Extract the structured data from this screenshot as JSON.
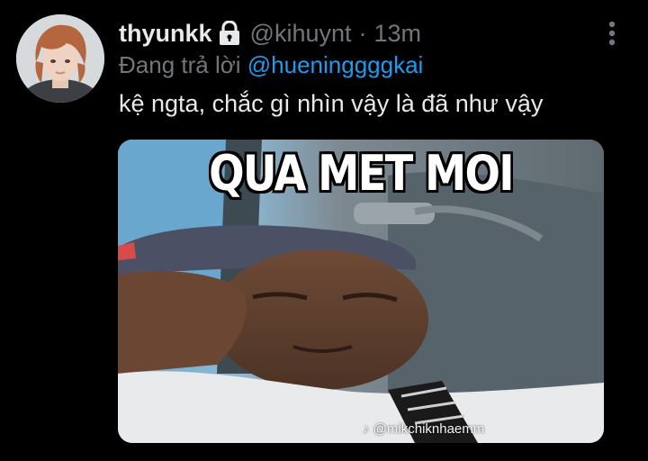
{
  "tweet": {
    "display_name": "thyunkk",
    "handle": "@kihuynt",
    "separator": "·",
    "time": "13m",
    "reply_prefix": "Đang trả lời ",
    "reply_to": "@hueninggggkai",
    "text": "kệ ngta, chắc gì nhìn vậy là đã như vậy",
    "protected_icon": "lock-icon",
    "more_icon": "more-vertical-icon"
  },
  "media": {
    "caption": "QUA MET MOI",
    "watermark": "♪ @mikchiknhaemm"
  },
  "colors": {
    "background": "#000000",
    "text_primary": "#e7e9ea",
    "text_secondary": "#71767b",
    "link": "#1d9bf0"
  }
}
